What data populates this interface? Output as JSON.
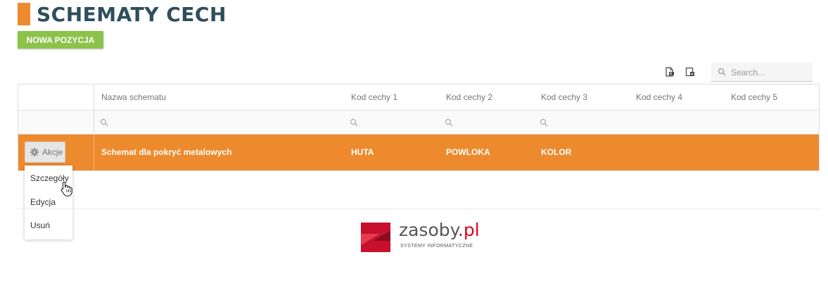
{
  "page": {
    "title": "SCHEMATY CECH",
    "new_button": "NOWA POZYCJA"
  },
  "toolbar": {
    "search_placeholder": "Search...",
    "icons": [
      "export-excel-icon",
      "column-chooser-icon",
      "search-icon"
    ]
  },
  "grid": {
    "columns": [
      "Nazwa schematu",
      "Kod cechy 1",
      "Kod cechy 2",
      "Kod cechy 3",
      "Kod cechy 4",
      "Kod cechy 5"
    ],
    "rows": [
      {
        "actions_label": "Akcje",
        "cells": [
          "Schemat dla pokryć metalowych",
          "HUTA",
          "POWLOKA",
          "KOLOR",
          "",
          ""
        ]
      }
    ]
  },
  "actions_menu": {
    "items": [
      "Szczegóły",
      "Edycja",
      "Usuń"
    ]
  },
  "footer": {
    "logo_text": "zasoby",
    "logo_accent": ".pl",
    "logo_subtitle": "SYSTEMY INFORMATYCZNE"
  },
  "colors": {
    "accent_orange": "#ed8a2d",
    "button_green": "#8bc34a",
    "title_color": "#2e4e5c",
    "logo_red": "#e2001a"
  }
}
